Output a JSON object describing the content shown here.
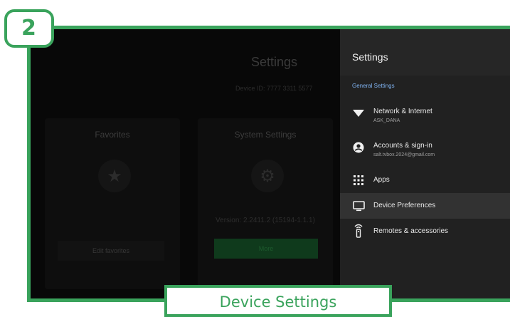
{
  "step_badge": "2",
  "caption": "Device Settings",
  "background_app": {
    "title": "Settings",
    "device_id": "Device ID: 7777 3311 5577",
    "favorites_title": "Favorites",
    "edit_favorites": "Edit favorites",
    "system_settings_title": "System Settings",
    "version": "Version: 2.2411.2 (15194-1.1.1)",
    "more_button": "More"
  },
  "settings_panel": {
    "title": "Settings",
    "section": "General Settings",
    "items": [
      {
        "label": "Network & Internet",
        "sub": "ASK_DANA",
        "icon": "wifi-icon"
      },
      {
        "label": "Accounts & sign-in",
        "sub": "salt.tvbox.2024@gmail.com",
        "icon": "account-icon"
      },
      {
        "label": "Apps",
        "sub": "",
        "icon": "apps-grid-icon"
      },
      {
        "label": "Device Preferences",
        "sub": "",
        "icon": "tv-icon",
        "selected": true
      },
      {
        "label": "Remotes & accessories",
        "sub": "",
        "icon": "remote-icon"
      }
    ]
  },
  "colors": {
    "accent": "#3aa35c",
    "section_label": "#7fb2f0",
    "panel_bg": "#212121",
    "selected_row": "#323232"
  }
}
